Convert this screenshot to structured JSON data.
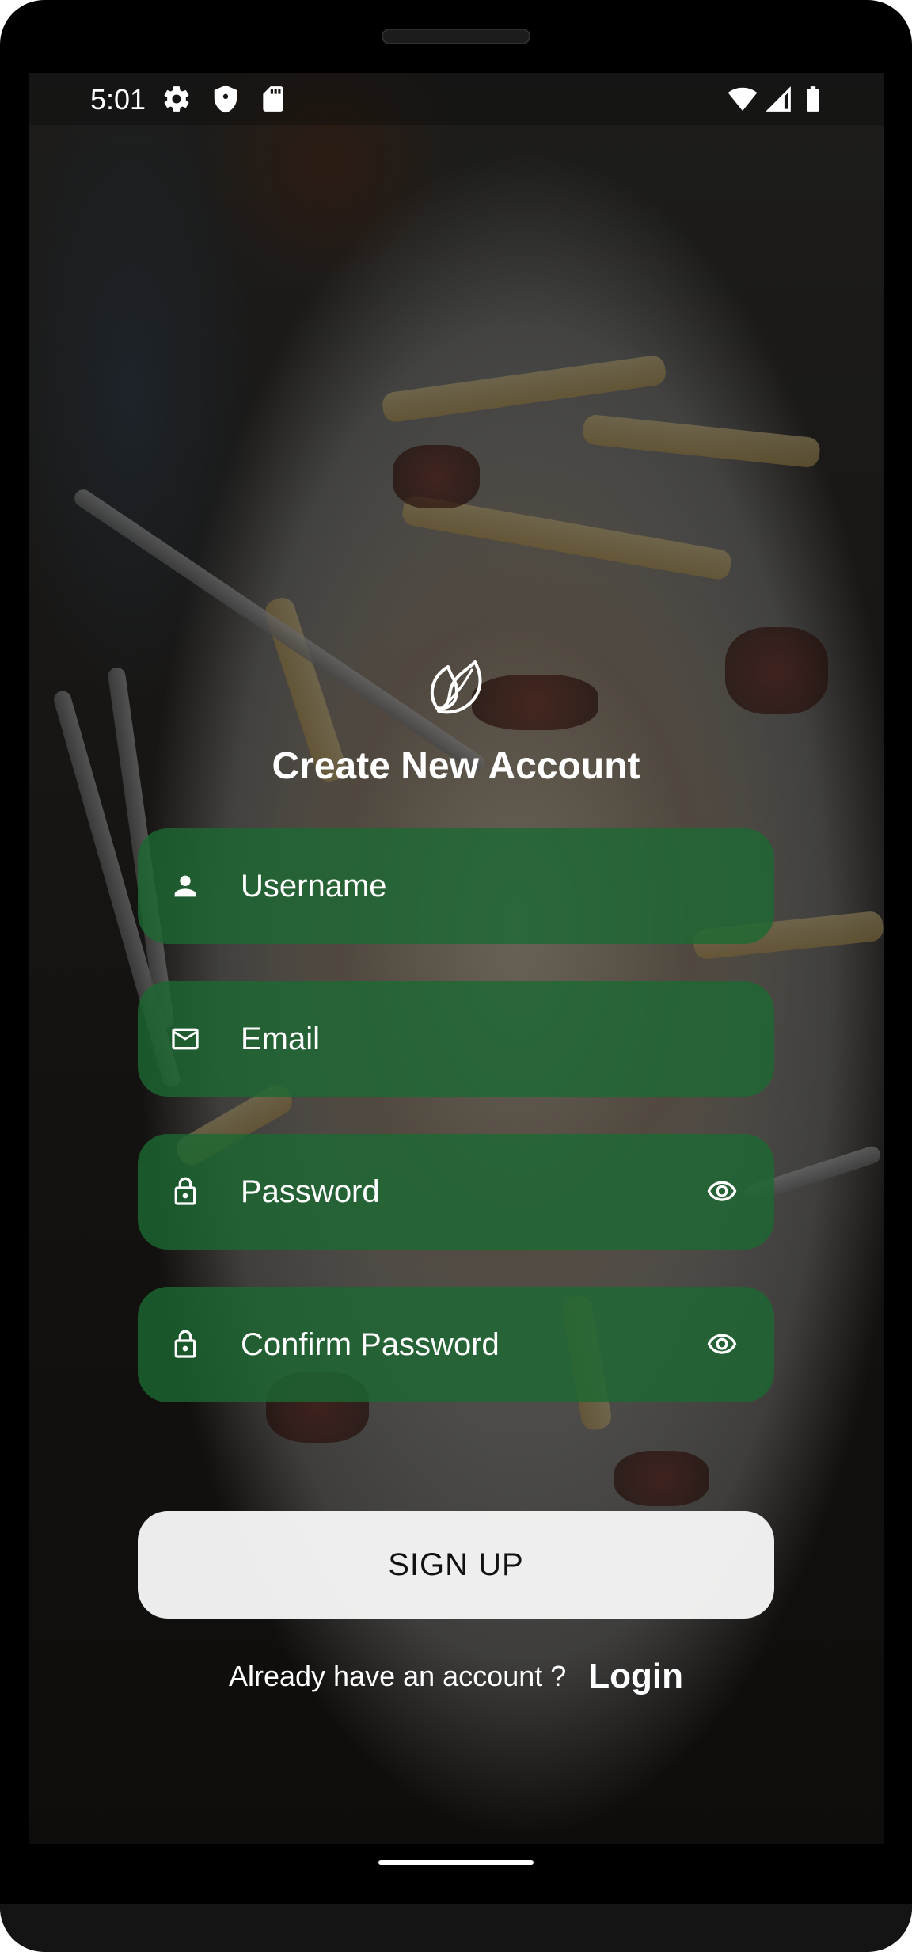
{
  "status_bar": {
    "time": "5:01",
    "left_icons": [
      "gear-icon",
      "shield-icon",
      "sd-card-icon"
    ],
    "right_icons": [
      "wifi-icon",
      "cell-signal-icon",
      "battery-icon"
    ]
  },
  "app": {
    "logo_icon": "leaf-icon",
    "title": "Create New Account"
  },
  "form": {
    "username_placeholder": "Username",
    "email_placeholder": "Email",
    "password_placeholder": "Password",
    "confirm_password_placeholder": "Confirm Password",
    "field_icons": {
      "username": "person-icon",
      "email": "mail-icon",
      "password": "lock-icon",
      "confirm_password": "lock-icon",
      "visibility_toggle": "eye-icon"
    }
  },
  "actions": {
    "signup_label": "SIGN UP",
    "login_prompt": "Already have an account ?",
    "login_link": "Login"
  },
  "colors": {
    "field_background": "#1C6932",
    "button_background": "#F6F6F6",
    "text_on_dark": "#FFFFFF"
  }
}
